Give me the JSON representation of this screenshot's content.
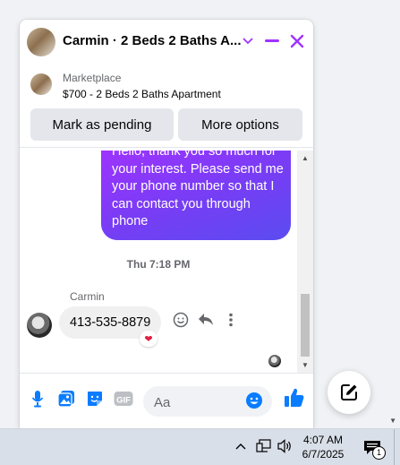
{
  "header": {
    "title": "Carmin · 2 Beds 2 Baths A...",
    "accent_color": "#a033ff"
  },
  "marketplace": {
    "label": "Marketplace",
    "listing": "$700 - 2 Beds 2 Baths Apartment"
  },
  "actions": {
    "mark_pending": "Mark as pending",
    "more_options": "More options"
  },
  "messages": {
    "outgoing_text": "Hello, thank you so much for your interest. Please send me your phone number so that I can contact you through phone",
    "timestamp": "Thu 7:18 PM",
    "sender_name": "Carmin",
    "incoming_text": "413-535-8879",
    "reaction": "❤"
  },
  "composer": {
    "placeholder": "Aa",
    "gif_label": "GIF"
  },
  "taskbar": {
    "time": "4:07 AM",
    "date": "6/7/2025",
    "notification_count": "1"
  }
}
